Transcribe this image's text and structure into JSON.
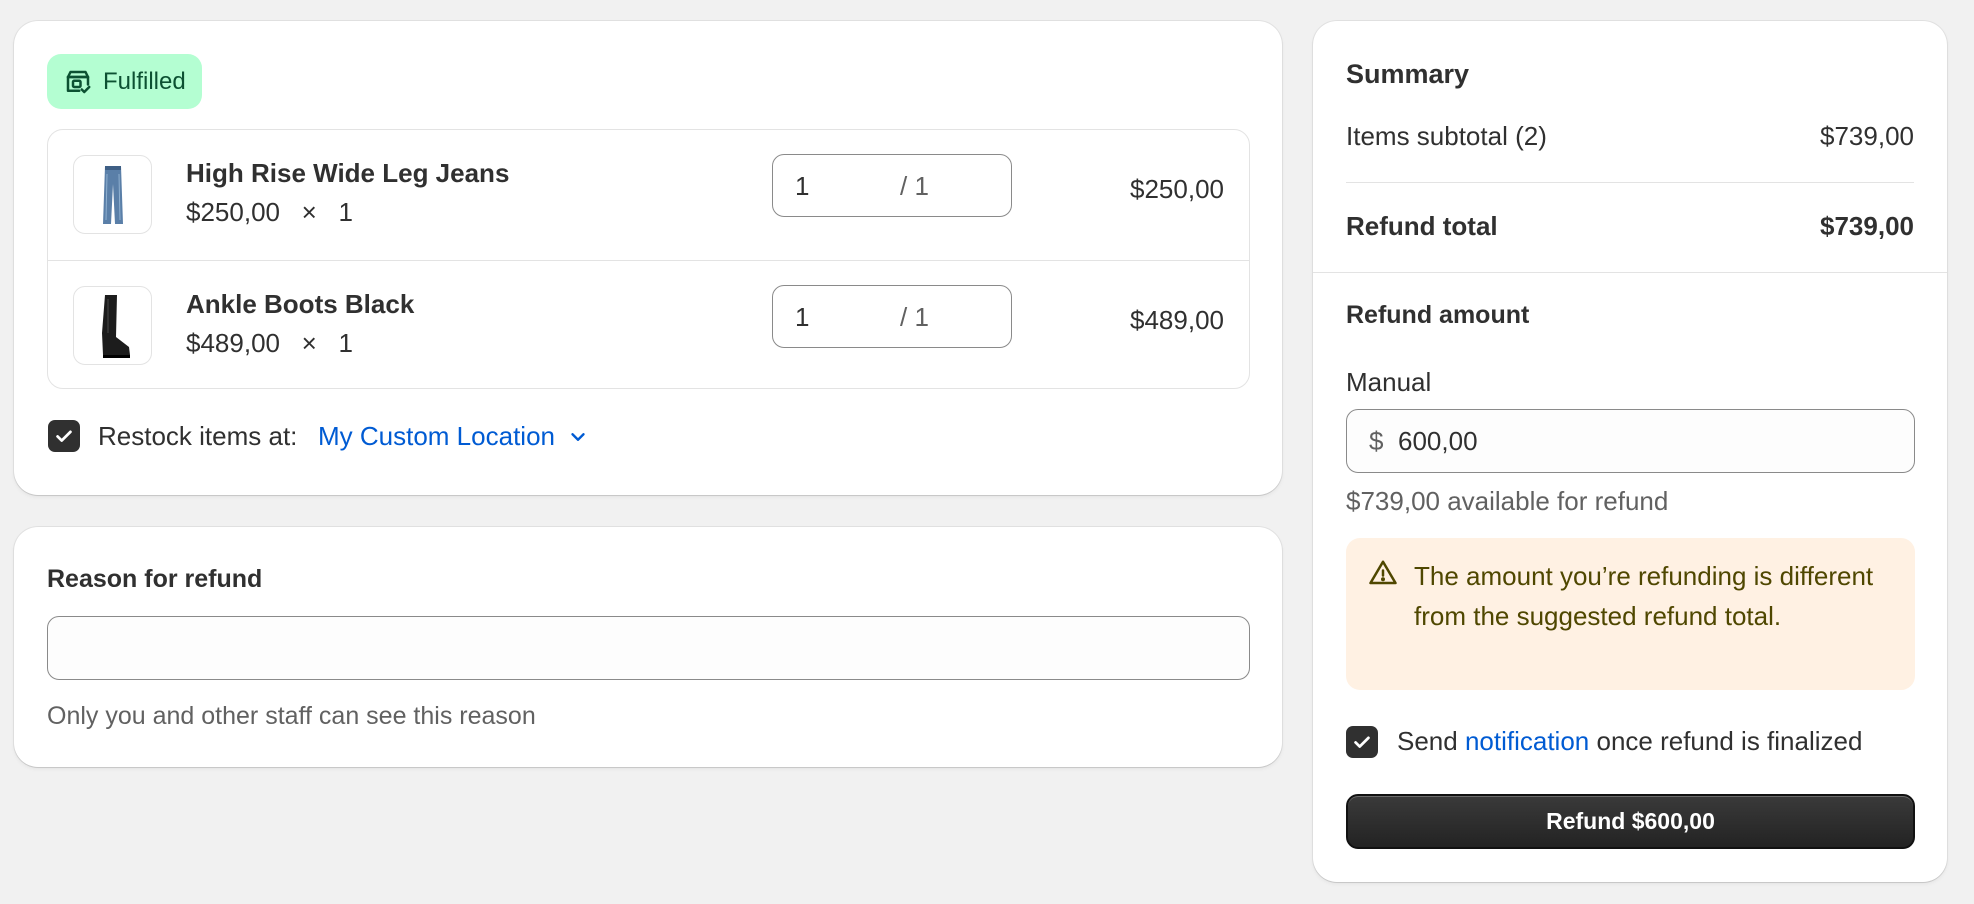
{
  "fulfillment": {
    "status_label": "Fulfilled",
    "status_icon": "package-check-icon",
    "badge_color": "#b4fed2",
    "items": [
      {
        "name": "High Rise Wide Leg Jeans",
        "unit_price": "$250,00",
        "times": "×",
        "qty": "1",
        "selected_qty": "1",
        "max_qty": "/ 1",
        "total": "$250,00",
        "thumb": "jeans-image"
      },
      {
        "name": "Ankle Boots Black",
        "unit_price": "$489,00",
        "times": "×",
        "qty": "1",
        "selected_qty": "1",
        "max_qty": "/ 1",
        "total": "$489,00",
        "thumb": "boots-image"
      }
    ],
    "restock": {
      "checked": true,
      "label": "Restock items at:",
      "location": "My Custom Location"
    }
  },
  "reason": {
    "title": "Reason for refund",
    "value": "",
    "help": "Only you and other staff can see this reason"
  },
  "summary": {
    "title": "Summary",
    "subtotal_label": "Items subtotal (2)",
    "subtotal_value": "$739,00",
    "refund_total_label": "Refund total",
    "refund_total_value": "$739,00",
    "refund_amount_title": "Refund amount",
    "manual_label": "Manual",
    "currency_prefix": "$",
    "amount_value": "600,00",
    "available_text": "$739,00 available for refund",
    "warning_text": "The amount you’re refunding is different from the suggested refund total.",
    "warning_color": "#fff1e3",
    "notify": {
      "checked": true,
      "before": "Send ",
      "link": "notification",
      "after": " once refund is finalized"
    },
    "refund_button": "Refund $600,00",
    "link_color": "#005bd3"
  }
}
